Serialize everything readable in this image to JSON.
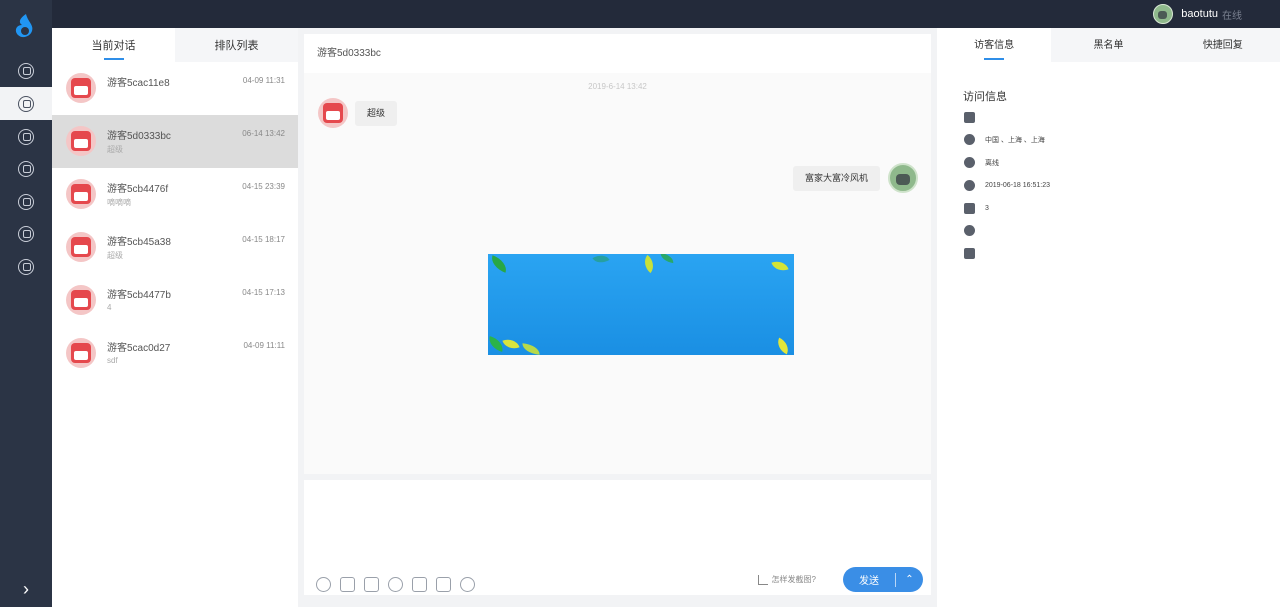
{
  "sidebar": {
    "nav": [
      {
        "icon": "home-icon"
      },
      {
        "icon": "chat-icon",
        "active": true
      },
      {
        "icon": "history-icon"
      },
      {
        "icon": "star-icon"
      },
      {
        "icon": "visitor-icon"
      },
      {
        "icon": "statistics-icon"
      },
      {
        "icon": "settings-icon"
      }
    ],
    "expand_glyph": "›"
  },
  "topbar": {
    "username": "baotutu",
    "status": "在线"
  },
  "left_panel": {
    "tabs": [
      "当前对话",
      "排队列表"
    ],
    "conversations": [
      {
        "name": "游客5cac11e8",
        "time": "04-09 11:31",
        "msg": ""
      },
      {
        "name": "游客5d0333bc",
        "time": "06-14 13:42",
        "msg": "超级"
      },
      {
        "name": "游客5cb4476f",
        "time": "04-15 23:39",
        "msg": "嘀嘀嘀"
      },
      {
        "name": "游客5cb45a38",
        "time": "04-15 18:17",
        "msg": "超级"
      },
      {
        "name": "游客5cb4477b",
        "time": "04-15 17:13",
        "msg": "4"
      },
      {
        "name": "游客5cac0d27",
        "time": "04-09 11:11",
        "msg": "sdf"
      }
    ]
  },
  "chat": {
    "title": "游客5d0333bc",
    "timestamp": "2019-6-14 13:42",
    "visitor_message": "超级",
    "agent_message": "富家大富冷风机"
  },
  "composer": {
    "screenshot_hint": "怎样发截图?",
    "send_label": "发送",
    "dropdown_glyph": "⌃"
  },
  "right_panel": {
    "tabs": [
      "访客信息",
      "黑名单",
      "快捷回复"
    ],
    "section_title": "访问信息",
    "rows": [
      {
        "icon": "bookmark-icon",
        "text": ""
      },
      {
        "icon": "location-icon",
        "text": "中国 、上海 、上海"
      },
      {
        "icon": "target-icon",
        "text": "离线"
      },
      {
        "icon": "clock-icon",
        "text": "2019-06-18 16:51:23"
      },
      {
        "icon": "activity-icon",
        "text": "3"
      },
      {
        "icon": "user-icon",
        "text": ""
      },
      {
        "icon": "phone-icon",
        "text": ""
      }
    ]
  }
}
